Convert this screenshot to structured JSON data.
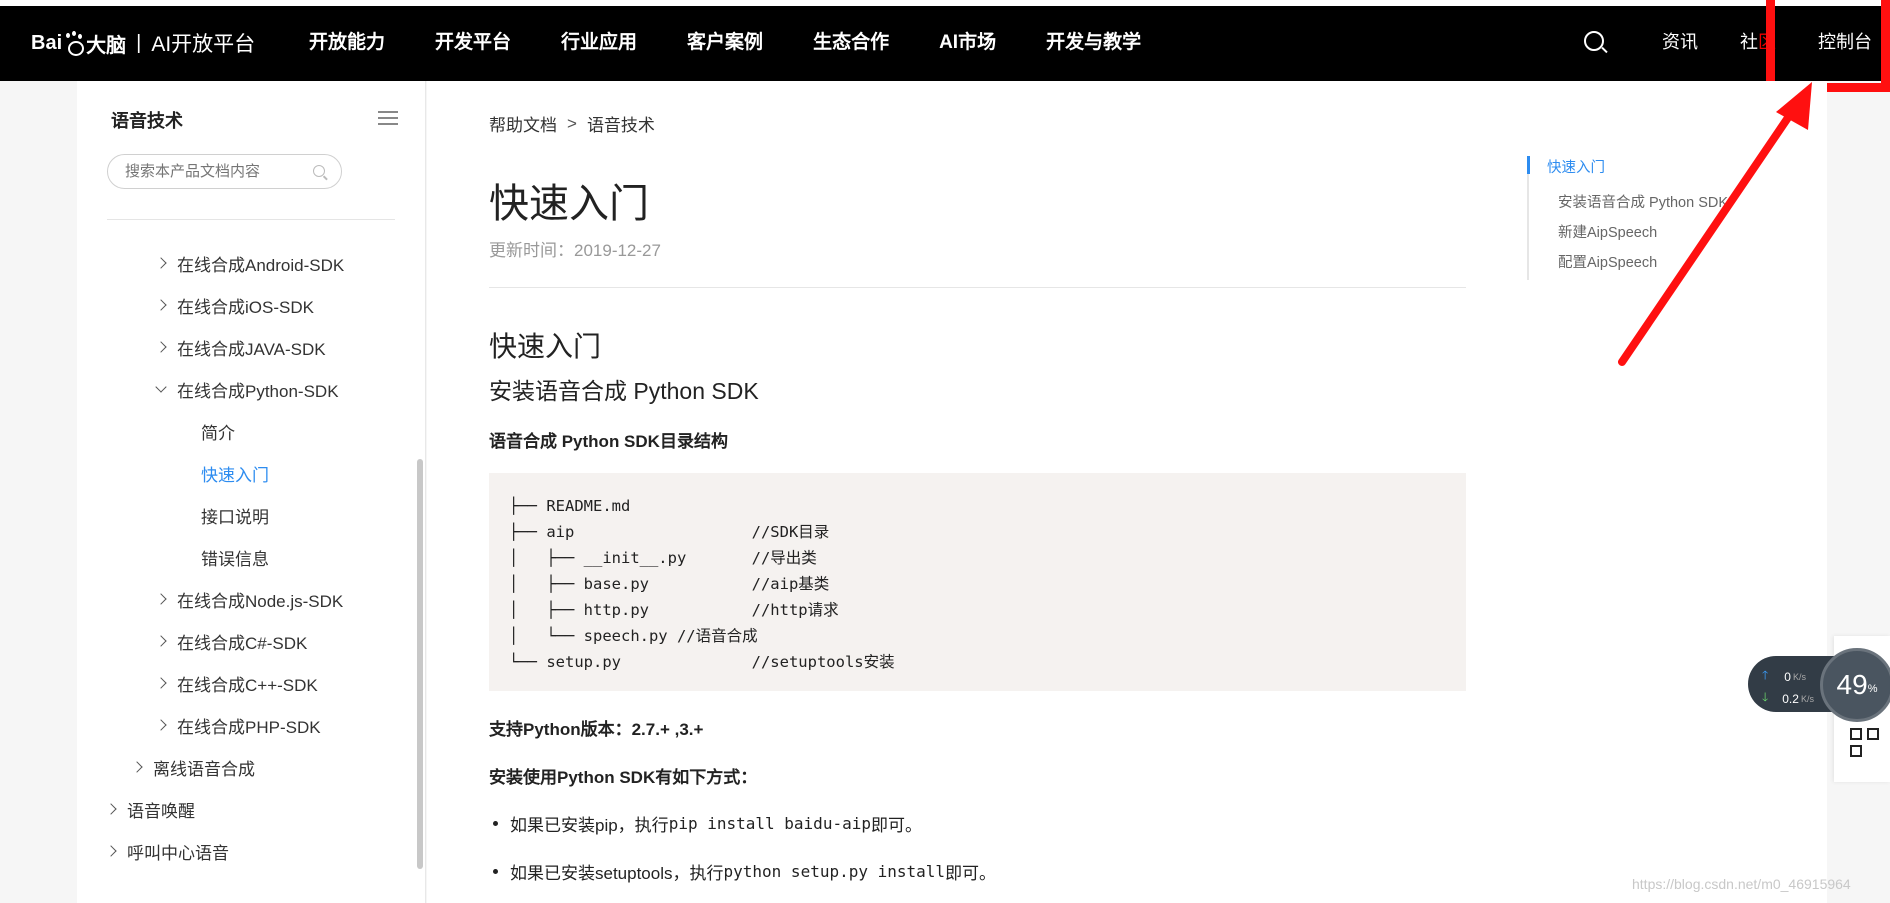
{
  "topbar": {
    "logo_left": "Bai",
    "logo_right": "大脑",
    "logo_sep": "|",
    "logo_platform": "AI开放平台",
    "nav": [
      "开放能力",
      "开发平台",
      "行业应用",
      "客户案例",
      "生态合作",
      "AI市场",
      "开发与教学"
    ],
    "right": {
      "news": "资讯",
      "community_a": "社",
      "community_b": "区",
      "console": "控制台"
    }
  },
  "sidebar": {
    "title": "语音技术",
    "search_placeholder": "搜索本产品文档内容",
    "items": [
      {
        "label": "在线合成Android-SDK",
        "chevron": "right"
      },
      {
        "label": "在线合成iOS-SDK",
        "chevron": "right"
      },
      {
        "label": "在线合成JAVA-SDK",
        "chevron": "right"
      },
      {
        "label": "在线合成Python-SDK",
        "chevron": "down"
      },
      {
        "label": "简介"
      },
      {
        "label": "快速入门",
        "active": true
      },
      {
        "label": "接口说明"
      },
      {
        "label": "错误信息"
      },
      {
        "label": "在线合成Node.js-SDK",
        "chevron": "right"
      },
      {
        "label": "在线合成C#-SDK",
        "chevron": "right"
      },
      {
        "label": "在线合成C++-SDK",
        "chevron": "right"
      },
      {
        "label": "在线合成PHP-SDK",
        "chevron": "right"
      },
      {
        "label": "离线语音合成",
        "chevron": "right"
      },
      {
        "label": "语音唤醒",
        "chevron": "right"
      },
      {
        "label": "呼叫中心语音",
        "chevron": "right"
      }
    ]
  },
  "main": {
    "breadcrumb": [
      "帮助文档",
      "语音技术"
    ],
    "breadcrumb_sep": ">",
    "title": "快速入门",
    "updated": "更新时间：2019-12-27",
    "h1": "快速入门",
    "h2": "安装语音合成 Python SDK",
    "dir_title": "语音合成 Python SDK目录结构",
    "code": [
      "├── README.md",
      "├── aip                   //SDK目录",
      "│   ├── __init__.py       //导出类",
      "│   ├── base.py           //aip基类",
      "│   ├── http.py           //http请求",
      "│   └── speech.py //语音合成",
      "└── setup.py              //setuptools安装"
    ],
    "support": "支持Python版本：2.7.+ ,3.+",
    "install_title": "安装使用Python SDK有如下方式：",
    "bullets": [
      {
        "pre": "如果已安装pip，执行",
        "code": "pip install baidu-aip",
        "post": "即可。"
      },
      {
        "pre": "如果已安装setuptools，执行",
        "code": "python setup.py install",
        "post": "即可。"
      }
    ]
  },
  "toc": [
    "快速入门",
    "安装语音合成 Python SDK",
    "新建AipSpeech",
    "配置AipSpeech"
  ],
  "netwidget": {
    "up": "0",
    "down": "0.2",
    "unit": "K/s",
    "percent": "49",
    "percent_unit": "%"
  },
  "watermark": "https://blog.csdn.net/m0_46915964",
  "colors": {
    "accent": "#2d8cf0",
    "annotation": "#ff1010",
    "topbar": "#000000"
  }
}
